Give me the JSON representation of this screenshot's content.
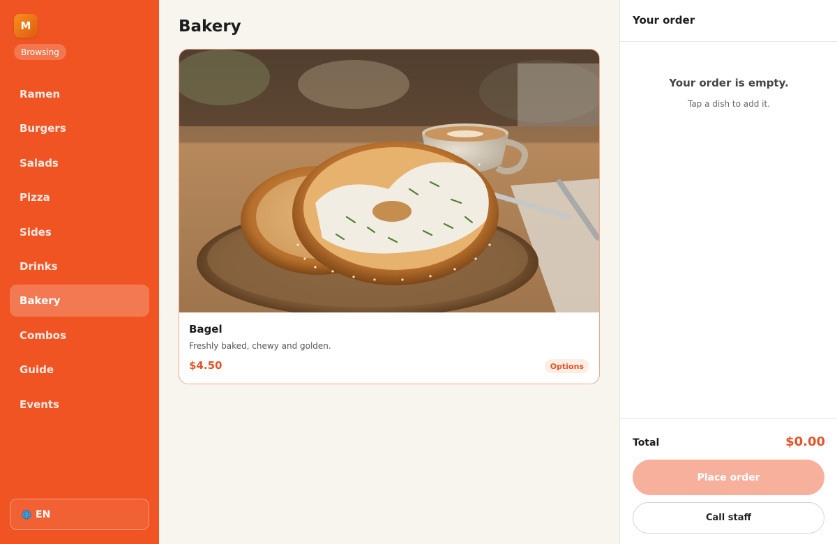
{
  "app": {
    "logo_letter": "M",
    "status": "Browsing"
  },
  "sidebar": {
    "items": [
      {
        "label": "Ramen",
        "active": false
      },
      {
        "label": "Burgers",
        "active": false
      },
      {
        "label": "Salads",
        "active": false
      },
      {
        "label": "Pizza",
        "active": false
      },
      {
        "label": "Sides",
        "active": false
      },
      {
        "label": "Drinks",
        "active": false
      },
      {
        "label": "Bakery",
        "active": true
      },
      {
        "label": "Combos",
        "active": false
      },
      {
        "label": "Guide",
        "active": false
      },
      {
        "label": "Events",
        "active": false
      }
    ],
    "language": {
      "icon": "globe-icon",
      "label": "EN"
    }
  },
  "main": {
    "title": "Bakery",
    "items": [
      {
        "name": "Bagel",
        "description": "Freshly baked, chewy and golden.",
        "price": "$4.50",
        "badge": "Options",
        "image": "bagel-photo"
      }
    ]
  },
  "order": {
    "title": "Your order",
    "empty_title": "Your order is empty.",
    "empty_hint": "Tap a dish to add it.",
    "total_label": "Total",
    "total_value": "$0.00",
    "place_order_label": "Place order",
    "call_staff_label": "Call staff"
  },
  "colors": {
    "brand": "#f05423",
    "accent": "#e2542a",
    "place_order_disabled": "#f7b09c",
    "background": "#f8f5ef"
  }
}
